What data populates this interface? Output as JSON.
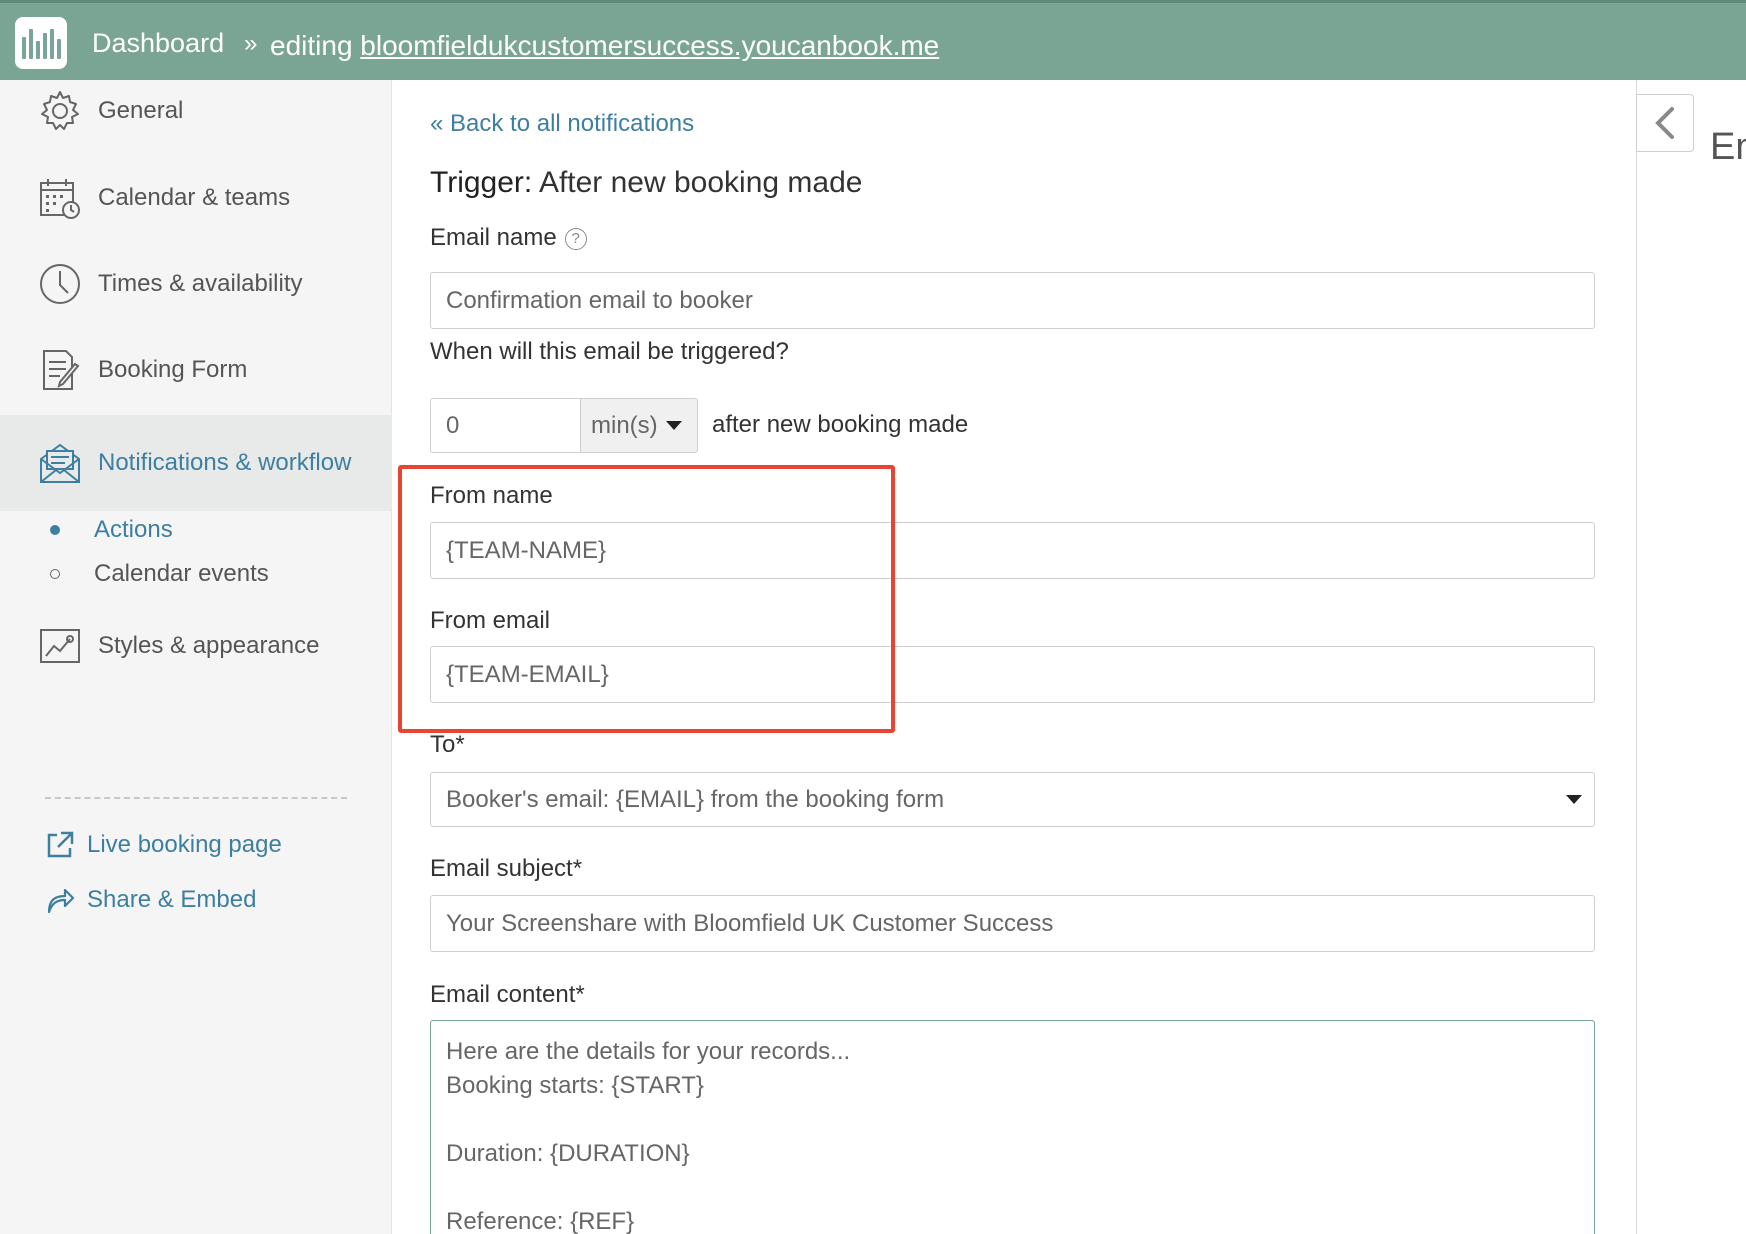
{
  "header": {
    "dashboard_label": "Dashboard",
    "separator": "»",
    "editing_prefix": "editing",
    "editing_domain": "bloomfieldukcustomersuccess.youcanbook.me"
  },
  "sidebar": {
    "items": [
      {
        "label": "General"
      },
      {
        "label": "Calendar & teams"
      },
      {
        "label": "Times & availability"
      },
      {
        "label": "Booking Form"
      },
      {
        "label": "Notifications & workflow"
      },
      {
        "label": "Styles & appearance"
      }
    ],
    "sub_items": [
      {
        "label": "Actions"
      },
      {
        "label": "Calendar events"
      }
    ],
    "links": [
      {
        "label": "Live booking page"
      },
      {
        "label": "Share & Embed"
      }
    ]
  },
  "main": {
    "back_link": "« Back to all notifications",
    "trigger_label": "Trigger:",
    "trigger_value": "After new booking made",
    "email_name_label": "Email name",
    "email_name_value": "Confirmation email to booker",
    "when_label": "When will this email be triggered?",
    "when_amount": "0",
    "when_unit": "min(s)",
    "when_suffix": "after new booking made",
    "from_name_label": "From name",
    "from_name_value": "{TEAM-NAME}",
    "from_email_label": "From email",
    "from_email_value": "{TEAM-EMAIL}",
    "to_label": "To*",
    "to_value": "Booker's email: {EMAIL} from the booking form",
    "subject_label": "Email subject*",
    "subject_value": "Your Screenshare with Bloomfield UK Customer Success",
    "content_label": "Email content*",
    "content_lines": [
      "Here are the details for your records...",
      "Booking starts: {START}",
      "",
      "Duration: {DURATION}",
      "",
      "Reference: {REF}"
    ]
  },
  "right_panel": {
    "partial_text": "En"
  },
  "colors": {
    "header": "#7aa595",
    "accent_blue": "#3d7fa0",
    "highlight_red": "#e74434"
  }
}
